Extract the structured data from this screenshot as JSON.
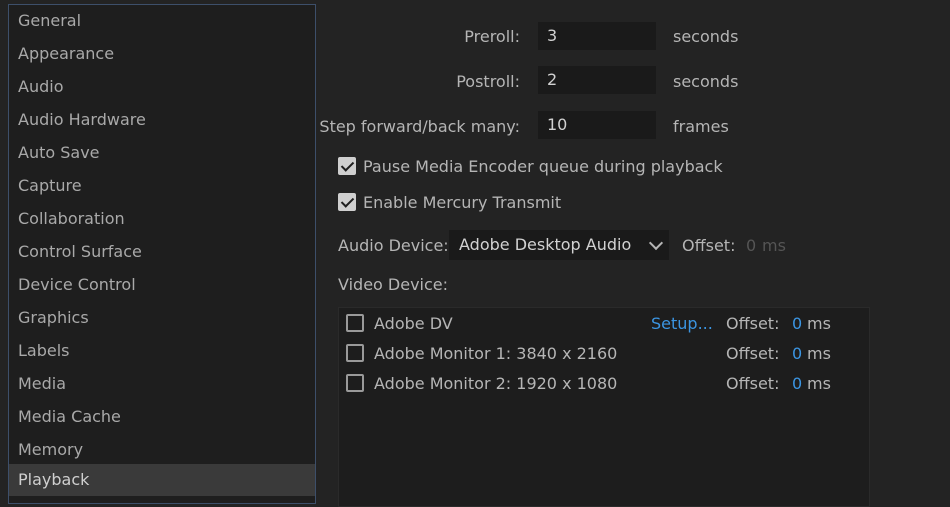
{
  "sidebar": {
    "items": [
      {
        "label": "General"
      },
      {
        "label": "Appearance"
      },
      {
        "label": "Audio"
      },
      {
        "label": "Audio Hardware"
      },
      {
        "label": "Auto Save"
      },
      {
        "label": "Capture"
      },
      {
        "label": "Collaboration"
      },
      {
        "label": "Control Surface"
      },
      {
        "label": "Device Control"
      },
      {
        "label": "Graphics"
      },
      {
        "label": "Labels"
      },
      {
        "label": "Media"
      },
      {
        "label": "Media Cache"
      },
      {
        "label": "Memory"
      },
      {
        "label": "Playback"
      }
    ],
    "selected": "Playback"
  },
  "playback": {
    "preroll": {
      "label": "Preroll:",
      "value": "3",
      "unit": "seconds"
    },
    "postroll": {
      "label": "Postroll:",
      "value": "2",
      "unit": "seconds"
    },
    "step": {
      "label": "Step forward/back many:",
      "value": "10",
      "unit": "frames"
    },
    "pause_encoder": {
      "label": "Pause Media Encoder queue during playback",
      "checked": true
    },
    "mercury": {
      "label": "Enable Mercury Transmit",
      "checked": true
    },
    "audio_device": {
      "label": "Audio Device:",
      "value": "Adobe Desktop Audio",
      "offset_label": "Offset:",
      "offset_value": "0",
      "offset_unit": "ms"
    },
    "video_device_label": "Video Device:",
    "video_devices": [
      {
        "name": "Adobe DV",
        "setup": "Setup...",
        "offset_label": "Offset:",
        "offset": "0",
        "unit": "ms",
        "checked": false
      },
      {
        "name": "Adobe Monitor 1: 3840 x 2160",
        "offset_label": "Offset:",
        "offset": "0",
        "unit": "ms",
        "checked": false
      },
      {
        "name": "Adobe Monitor 2: 1920 x 1080",
        "offset_label": "Offset:",
        "offset": "0",
        "unit": "ms",
        "checked": false
      }
    ]
  },
  "colors": {
    "accent": "#3b95e2",
    "selection": "#3a3a3a",
    "panel": "#232323"
  }
}
